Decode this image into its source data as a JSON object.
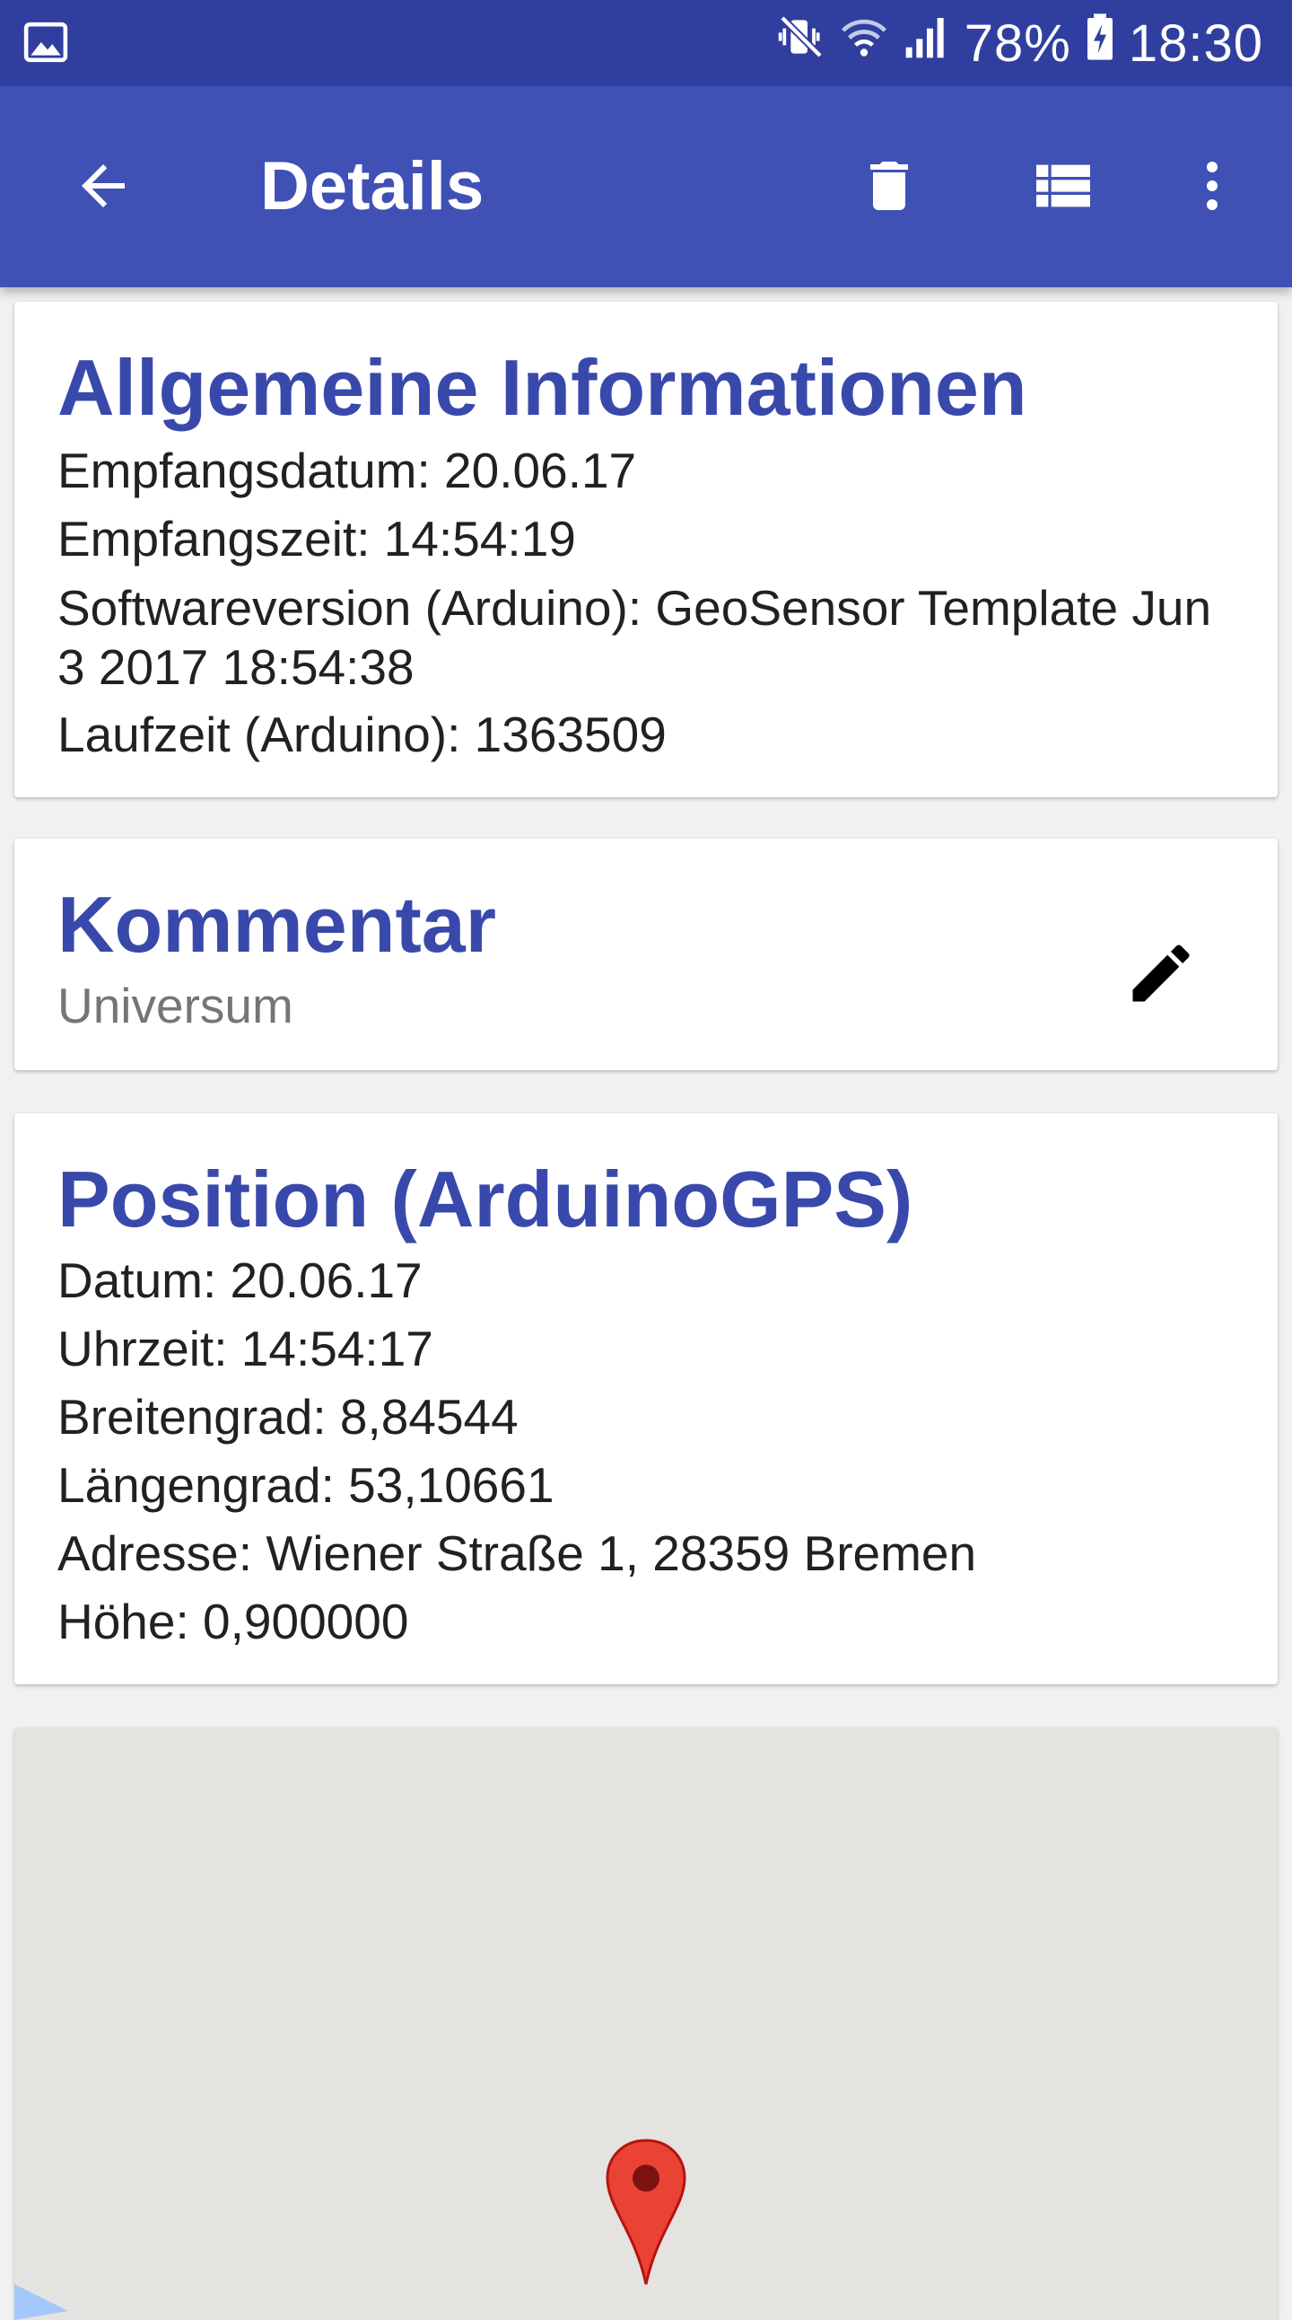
{
  "status_bar": {
    "battery": "78%",
    "time": "18:30",
    "icons": [
      "gallery-notification-icon",
      "mute-vibrate-icon",
      "wifi-icon",
      "signal-icon",
      "battery-charging-icon"
    ]
  },
  "app_bar": {
    "title": "Details",
    "icons": [
      "arrow-back-icon",
      "delete-icon",
      "list-icon",
      "more-vert-icon"
    ]
  },
  "general": {
    "title": "Allgemeine Informationen",
    "receive_date": "Empfangsdatum: 20.06.17",
    "receive_time": "Empfangszeit: 14:54:19",
    "software_version": "Softwareversion (Arduino): GeoSensor Template Jun 3 2017 18:54:38",
    "runtime": "Laufzeit (Arduino): 1363509"
  },
  "comment": {
    "title": "Kommentar",
    "text": "Universum",
    "icon": "edit-pencil-icon"
  },
  "position": {
    "title": "Position (ArduinoGPS)",
    "date": "Datum: 20.06.17",
    "time": "Uhrzeit: 14:54:17",
    "latitude": "Breitengrad: 8,84544",
    "longitude": "Längengrad: 53,10661",
    "address": "Adresse: Wiener Straße 1, 28359 Bremen",
    "altitude": "Höhe: 0,900000"
  },
  "map": {
    "marker_icon": "map-pin-icon",
    "background_color": "#e5e3df",
    "water_color": "#a4c8fb",
    "marker_color": "#ea4335"
  },
  "colors": {
    "status_bar": "#303f9f",
    "app_bar": "#3f51b5",
    "card_title": "#3949ab"
  }
}
